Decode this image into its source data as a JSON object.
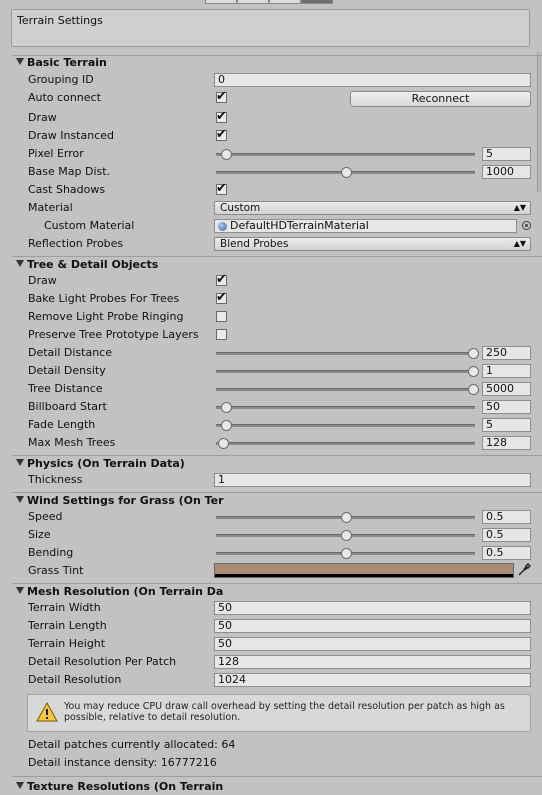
{
  "settings_title": "Terrain Settings",
  "basic": {
    "header": "Basic Terrain",
    "grouping_id_label": "Grouping ID",
    "grouping_id_value": "0",
    "auto_connect_label": "Auto connect",
    "auto_connect": true,
    "reconnect_label": "Reconnect",
    "draw_label": "Draw",
    "draw": true,
    "draw_instanced_label": "Draw Instanced",
    "draw_instanced": true,
    "pixel_error_label": "Pixel Error",
    "pixel_error_value": "5",
    "pixel_error_level": 0.03,
    "base_map_label": "Base Map Dist.",
    "base_map_value": "1000",
    "base_map_level": 0.5,
    "cast_shadows_label": "Cast Shadows",
    "cast_shadows": true,
    "material_label": "Material",
    "material_value": "Custom",
    "custom_material_label": "Custom Material",
    "custom_material_value": "DefaultHDTerrainMaterial",
    "reflection_label": "Reflection Probes",
    "reflection_value": "Blend Probes"
  },
  "tree": {
    "header": "Tree & Detail Objects",
    "draw_label": "Draw",
    "draw": true,
    "bake_label": "Bake Light Probes For Trees",
    "bake": true,
    "remove_label": "Remove Light Probe Ringing",
    "remove": false,
    "preserve_label": "Preserve Tree Prototype Layers",
    "preserve": false,
    "detail_distance_label": "Detail Distance",
    "detail_distance_value": "250",
    "detail_distance_level": 1.0,
    "detail_density_label": "Detail Density",
    "detail_density_value": "1",
    "detail_density_level": 1.0,
    "tree_distance_label": "Tree Distance",
    "tree_distance_value": "5000",
    "tree_distance_level": 1.0,
    "billboard_label": "Billboard Start",
    "billboard_value": "50",
    "billboard_level": 0.03,
    "fade_label": "Fade Length",
    "fade_value": "5",
    "fade_level": 0.03,
    "max_mesh_label": "Max Mesh Trees",
    "max_mesh_value": "128",
    "max_mesh_level": 0.02
  },
  "physics": {
    "header": "Physics (On Terrain Data)",
    "thickness_label": "Thickness",
    "thickness_value": "1"
  },
  "wind": {
    "header": "Wind Settings for Grass (On Ter",
    "speed_label": "Speed",
    "speed_value": "0.5",
    "speed_level": 0.5,
    "size_label": "Size",
    "size_value": "0.5",
    "size_level": 0.5,
    "bending_label": "Bending",
    "bending_value": "0.5",
    "bending_level": 0.5,
    "grass_tint_label": "Grass Tint",
    "grass_tint_color": "#a98b76"
  },
  "mesh": {
    "header": "Mesh Resolution (On Terrain Da",
    "width_label": "Terrain Width",
    "width_value": "50",
    "length_label": "Terrain Length",
    "length_value": "50",
    "height_label": "Terrain Height",
    "height_value": "50",
    "detail_per_patch_label": "Detail Resolution Per Patch",
    "detail_per_patch_value": "128",
    "detail_res_label": "Detail Resolution",
    "detail_res_value": "1024",
    "help_text": "You may reduce CPU draw call overhead by setting the detail resolution per patch as high as possible, relative to detail resolution.",
    "patches_text": "Detail patches currently allocated: 64",
    "density_text": "Detail instance density: 16777216"
  },
  "texture": {
    "header": "Texture Resolutions (On Terrain"
  },
  "icons": {
    "warning": "warning-icon",
    "eyedropper": "eyedropper-icon",
    "object_picker": "object-picker-icon",
    "dropdown_arrow": "dropdown-arrow-icon"
  },
  "colors": {
    "panel_bg": "#c2c2c2",
    "field_bg": "#e6e6e6",
    "grass_tint": "#a98b76"
  }
}
